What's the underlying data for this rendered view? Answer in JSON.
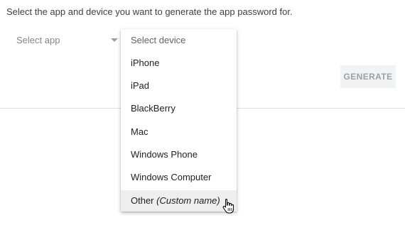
{
  "instructions": "Select the app and device you want to generate the app password for.",
  "app_select": {
    "label": "Select app"
  },
  "device_menu": {
    "header": "Select device",
    "items": [
      {
        "label": "iPhone"
      },
      {
        "label": "iPad"
      },
      {
        "label": "BlackBerry"
      },
      {
        "label": "Mac"
      },
      {
        "label": "Windows Phone"
      },
      {
        "label": "Windows Computer"
      },
      {
        "label": "Other",
        "suffix": "(Custom name)",
        "hovered": true
      }
    ]
  },
  "generate_button": {
    "label": "GENERATE"
  },
  "cursor": {
    "type": "hand-pointer-icon"
  }
}
